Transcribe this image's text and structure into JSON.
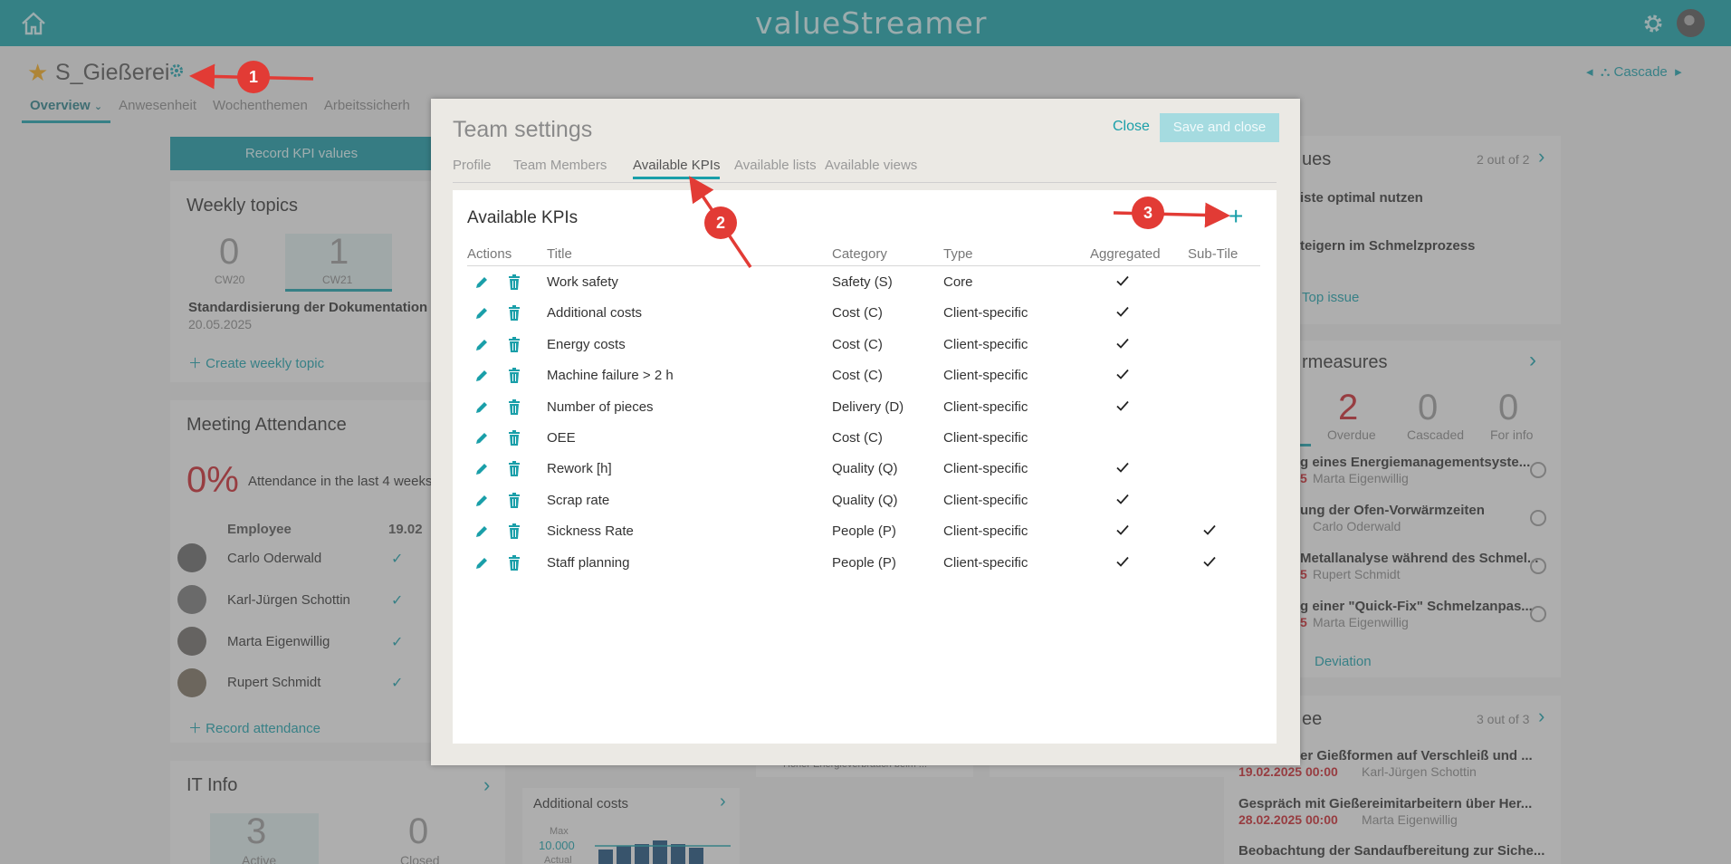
{
  "topbar": {
    "logo": "valueStreamer",
    "home_icon": "home-icon",
    "settings_icon": "gear-icon"
  },
  "header": {
    "team_name": "S_Gießerei",
    "tabs": [
      {
        "label": "Overview",
        "active": true
      },
      {
        "label": "Anwesenheit"
      },
      {
        "label": "Wochenthemen"
      },
      {
        "label": "Arbeitssicherh"
      }
    ],
    "cascade_label": "Cascade"
  },
  "dashboard": {
    "record_kpi_label": "Record KPI values",
    "weekly_topics": {
      "title": "Weekly topics",
      "counts": [
        {
          "value": "0",
          "week": "CW20"
        },
        {
          "value": "1",
          "week": "CW21"
        }
      ],
      "topic": "Standardisierung der Dokumentation fü",
      "topic_date": "20.05.2025",
      "create_label": "Create weekly topic"
    },
    "meeting_attendance": {
      "title": "Meeting Attendance",
      "percent": "0%",
      "caption": "Attendance in the last 4 weeks",
      "col_employee": "Employee",
      "col_date": "19.02",
      "employees": [
        "Carlo Oderwald",
        "Karl-Jürgen Schottin",
        "Marta Eigenwillig",
        "Rupert Schmidt"
      ],
      "record_label": "Record attendance"
    },
    "it_info": {
      "title": "IT Info",
      "active_count": "3",
      "active_label": "Active",
      "closed_count": "0",
      "closed_label": "Closed"
    },
    "additional_costs": {
      "title": "Additional costs",
      "max_label": "Max",
      "max_value": "10.000",
      "actual_label": "Actual"
    },
    "issues": {
      "title_fragment": "ues",
      "count": "2 out of 2",
      "items": [
        "iste optimal nutzen",
        "teigern im Schmelzprozess"
      ],
      "link": "Top issue"
    },
    "countermeasures": {
      "title_fragment": "rmeasures",
      "stats": [
        {
          "value": "2",
          "label": "Overdue"
        },
        {
          "value": "0",
          "label": "Cascaded"
        },
        {
          "value": "0",
          "label": "For info"
        }
      ],
      "items": [
        {
          "title": "g eines Energiemanagementsyste...",
          "date": "5",
          "person": "Marta Eigenwillig"
        },
        {
          "title": "ung der Ofen-Vorwärmzeiten",
          "date": "",
          "person": "Carlo Oderwald"
        },
        {
          "title": "Metallanalyse während des Schmel...",
          "date": "5",
          "person": "Rupert Schmidt"
        },
        {
          "title": "g einer \"Quick-Fix\" Schmelzanpas...",
          "date": "5",
          "person": "Marta Eigenwillig"
        }
      ],
      "link": "Deviation"
    },
    "ideas": {
      "title_fragment": "ee",
      "count": "3 out of 3",
      "items": [
        {
          "title": "er Gießformen auf Verschleiß und ...",
          "date": "19.02.2025 00:00",
          "person": "Karl-Jürgen Schottin"
        },
        {
          "title": "Gespräch mit Gießereimitarbeitern über Her...",
          "date": "28.02.2025 00:00",
          "person": "Marta Eigenwillig"
        },
        {
          "title": "Beobachtung der Sandaufbereitung zur Siche...",
          "date": "",
          "person": ""
        }
      ]
    },
    "alert_text": "Hoher Energieverbrauch beim ..."
  },
  "modal": {
    "title": "Team settings",
    "close_label": "Close",
    "save_label": "Save and close",
    "tabs": [
      {
        "label": "Profile"
      },
      {
        "label": "Team Members"
      },
      {
        "label": "Available KPIs",
        "active": true
      },
      {
        "label": "Available lists"
      },
      {
        "label": "Available views"
      }
    ],
    "panel_title": "Available KPIs",
    "columns": {
      "actions": "Actions",
      "title": "Title",
      "category": "Category",
      "type": "Type",
      "aggregated": "Aggregated",
      "subtile": "Sub-Tile"
    },
    "kpis": [
      {
        "title": "Work safety",
        "category": "Safety (S)",
        "type": "Core",
        "aggregated": true,
        "subtile": false
      },
      {
        "title": "Additional costs",
        "category": "Cost (C)",
        "type": "Client-specific",
        "aggregated": true,
        "subtile": false
      },
      {
        "title": "Energy costs",
        "category": "Cost (C)",
        "type": "Client-specific",
        "aggregated": true,
        "subtile": false
      },
      {
        "title": "Machine failure > 2 h",
        "category": "Cost (C)",
        "type": "Client-specific",
        "aggregated": true,
        "subtile": false
      },
      {
        "title": "Number of pieces",
        "category": "Delivery (D)",
        "type": "Client-specific",
        "aggregated": true,
        "subtile": false
      },
      {
        "title": "OEE",
        "category": "Cost (C)",
        "type": "Client-specific",
        "aggregated": false,
        "subtile": false
      },
      {
        "title": "Rework [h]",
        "category": "Quality (Q)",
        "type": "Client-specific",
        "aggregated": true,
        "subtile": false
      },
      {
        "title": "Scrap rate",
        "category": "Quality (Q)",
        "type": "Client-specific",
        "aggregated": true,
        "subtile": false
      },
      {
        "title": "Sickness Rate",
        "category": "People (P)",
        "type": "Client-specific",
        "aggregated": true,
        "subtile": true
      },
      {
        "title": "Staff planning",
        "category": "People (P)",
        "type": "Client-specific",
        "aggregated": true,
        "subtile": true
      }
    ]
  },
  "annotations": [
    "1",
    "2",
    "3"
  ],
  "colors": {
    "accent": "#1a9fa9",
    "topbar": "#17a0a8",
    "annotation": "#e23b35",
    "star": "#f3a81a",
    "overdue": "#c9252d"
  }
}
